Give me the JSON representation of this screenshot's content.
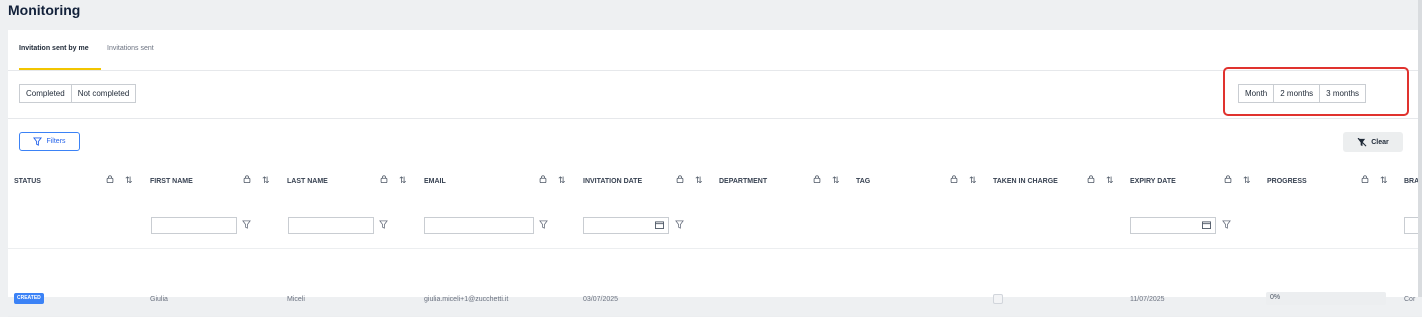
{
  "page": {
    "title": "Monitoring"
  },
  "tabs": [
    {
      "label": "Invitation sent by me",
      "active": true
    },
    {
      "label": "Invitations sent",
      "active": false
    }
  ],
  "status_filter": {
    "options": [
      "Completed",
      "Not completed"
    ]
  },
  "period_filter": {
    "options": [
      "Month",
      "2 months",
      "3 months"
    ]
  },
  "toolbar": {
    "filters_label": "Filters",
    "clear_label": "Clear"
  },
  "columns": [
    {
      "label": "STATUS"
    },
    {
      "label": "FIRST NAME"
    },
    {
      "label": "LAST NAME"
    },
    {
      "label": "EMAIL"
    },
    {
      "label": "INVITATION DATE"
    },
    {
      "label": "DEPARTMENT"
    },
    {
      "label": "TAG"
    },
    {
      "label": "TAKEN IN CHARGE"
    },
    {
      "label": "EXPIRY DATE"
    },
    {
      "label": "PROGRESS"
    },
    {
      "label": "BRA"
    }
  ],
  "rows": [
    {
      "status": "CREATED",
      "first_name": "Giulia",
      "last_name": "Miceli",
      "email": "giulia.miceli+1@zucchetti.it",
      "invitation_date": "03/07/2025",
      "taken_in_charge": false,
      "expiry_date": "11/07/2025",
      "progress": "0%",
      "branch": "Cor"
    }
  ],
  "colors": {
    "accent": "#f2c500",
    "primary": "#3b82f6",
    "highlight": "#e0322e"
  }
}
